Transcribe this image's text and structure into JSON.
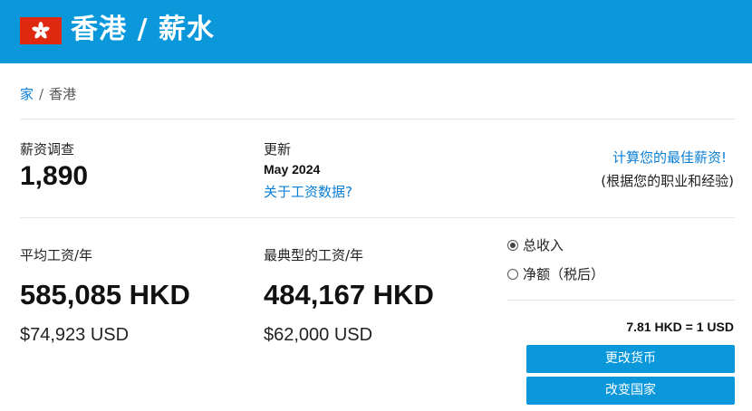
{
  "header": {
    "title": "香港 / 薪水",
    "flag": {
      "name": "hong-kong-flag-icon",
      "color": "#de2910"
    },
    "color": "#0a98db"
  },
  "breadcrumb": {
    "home": "家",
    "separator": "/",
    "current": "香港"
  },
  "stats": {
    "survey_label": "薪资调查",
    "survey_count": "1,890",
    "updated_label": "更新",
    "updated_date": "May 2024",
    "about_link": "关于工资数据?",
    "calc_link": "计算您的最佳薪资!",
    "calc_sub": "(根据您的职业和经验)"
  },
  "salary": {
    "average_label": "平均工资/年",
    "average_hkd": "585,085 HKD",
    "average_usd": "$74,923 USD",
    "typical_label": "最典型的工资/年",
    "typical_hkd": "484,167 HKD",
    "typical_usd": "$62,000 USD"
  },
  "options": {
    "radio_gross": "总收入",
    "radio_net": "净额（税后）",
    "selected": "gross"
  },
  "currency": {
    "rate": "7.81 HKD = 1 USD",
    "change_currency_button": "更改货币",
    "change_country_button": "改变国家"
  }
}
